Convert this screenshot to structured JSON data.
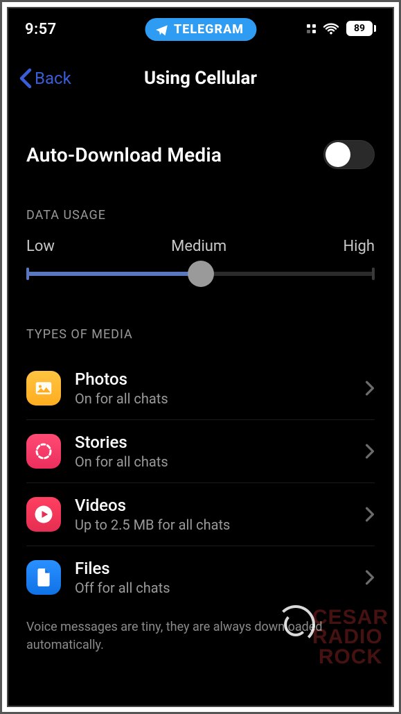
{
  "status": {
    "time": "9:57",
    "battery": "89"
  },
  "app_pill": {
    "label": "TELEGRAM"
  },
  "nav": {
    "back_label": "Back",
    "title": "Using Cellular"
  },
  "auto_download": {
    "label": "Auto-Download Media",
    "state": "off"
  },
  "data_usage": {
    "header": "DATA USAGE",
    "labels": {
      "low": "Low",
      "medium": "Medium",
      "high": "High"
    },
    "value_percent": 50
  },
  "types_header": "TYPES OF MEDIA",
  "media": [
    {
      "icon": "photos-icon",
      "title": "Photos",
      "subtitle": "On for all chats",
      "color": "bg-yellow"
    },
    {
      "icon": "stories-icon",
      "title": "Stories",
      "subtitle": "On for all chats",
      "color": "bg-pink"
    },
    {
      "icon": "videos-icon",
      "title": "Videos",
      "subtitle": "Up to 2.5 MB for all chats",
      "color": "bg-red"
    },
    {
      "icon": "files-icon",
      "title": "Files",
      "subtitle": "Off for all chats",
      "color": "bg-blue"
    }
  ],
  "footer_note": "Voice messages are tiny, they are always downloaded automatically.",
  "watermark": {
    "line1": "CESAR",
    "line2": "RADIO",
    "line3": "ROCK"
  }
}
